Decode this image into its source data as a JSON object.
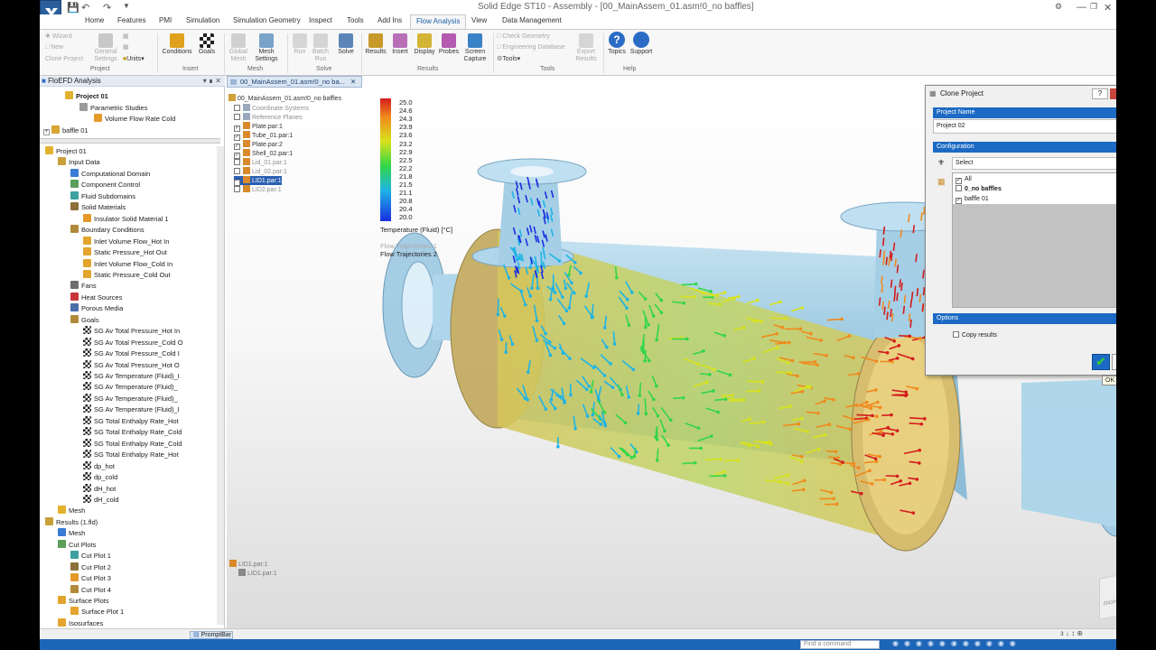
{
  "window": {
    "title": "Solid Edge ST10 - Assembly - [00_MainAssem_01.asm!0_no baffles]"
  },
  "ribbon_tabs": [
    "Home",
    "Features",
    "PMI",
    "Simulation",
    "Simulation Geometry",
    "Inspect",
    "Tools",
    "Add Ins",
    "Flow Analysis",
    "View",
    "Data Management"
  ],
  "ribbon": {
    "project": {
      "wizard": "Wizard",
      "new": "New",
      "clone": "Clone Project",
      "general": "General Settings",
      "units": "Units",
      "group": "Project"
    },
    "insert": {
      "conditions": "Conditions",
      "goals": "Goals",
      "group": "Insert"
    },
    "mesh": {
      "global": "Global Mesh",
      "settings": "Mesh Settings",
      "group": "Mesh"
    },
    "solve": {
      "run": "Run",
      "batch": "Batch Run",
      "solve": "Solve",
      "group": "Solve"
    },
    "results": {
      "results": "Results",
      "insert": "Insert",
      "display": "Display",
      "probes": "Probes",
      "capture": "Screen Capture",
      "group": "Results"
    },
    "tools": {
      "check": "Check Geometry",
      "engdb": "Engineering Database",
      "tools": "Tools",
      "export": "Export Results",
      "group": "Tools"
    },
    "help": {
      "topics": "Topics",
      "support": "Support",
      "group": "Help"
    }
  },
  "left_pane": {
    "title": "FloEFD Analysis",
    "top_tree": [
      "Project 01",
      "Parametric Studies",
      "Volume Flow Rate Cold",
      "baffle 01"
    ],
    "tree": [
      "Project 01",
      "Input Data",
      "Computational Domain",
      "Component Control",
      "Fluid Subdomains",
      "Solid Materials",
      "Insulator Solid Material 1",
      "Boundary Conditions",
      "Inlet Volume Flow_Hot In",
      "Static Pressure_Hot Out",
      "Inlet Volume Flow_Cold In",
      "Static Pressure_Cold Out",
      "Fans",
      "Heat Sources",
      "Porous Media",
      "Goals",
      "SG Av Total Pressure_Hot In",
      "SG Av Total Pressure_Cold O",
      "SG Av Total Pressure_Cold I",
      "SG Av Total Pressure_Hot O",
      "SG Av Temperature (Fluid)_I",
      "SG Av Temperature (Fluid)_",
      "SG Av Temperature (Fluid)_",
      "SG Av Temperature (Fluid)_I",
      "SG Total Enthalpy Rate_Hot",
      "SG Total Enthalpy Rate_Cold",
      "SG Total Enthalpy Rate_Cold",
      "SG Total Enthalpy Rate_Hot",
      "dp_hot",
      "dp_cold",
      "dH_hot",
      "dH_cold",
      "Mesh",
      "Results (1.fld)",
      "Mesh",
      "Cut Plots",
      "Cut Plot 1",
      "Cut Plot 2",
      "Cut Plot 3",
      "Cut Plot 4",
      "Surface Plots",
      "Surface Plot 1",
      "Isosurfaces"
    ]
  },
  "viewport": {
    "doc_tab": "00_MainAssem_01.asm!0_no ba...",
    "assembly": "00_MainAssem_01.asm!0_no baffles",
    "parts": [
      "Coordinate Systems",
      "Reference Planes",
      "Plate.par:1",
      "Tube_01.par:1",
      "Plate.par:2",
      "Shell_02.par:1",
      "Lid_01.par:1",
      "Lid_02.par:1",
      "LID1.par:1",
      "LID2.par:1"
    ],
    "legend_title": "Temperature (Fluid) [°C]",
    "legend_values": [
      "25.0",
      "24.6",
      "24.3",
      "23.9",
      "23.6",
      "23.2",
      "22.9",
      "22.5",
      "22.2",
      "21.8",
      "21.5",
      "21.1",
      "20.8",
      "20.4",
      "20.0"
    ],
    "trajectories": [
      "Flow Trajectories 1",
      "Flow Trajectories 2"
    ],
    "bottom_list": [
      "LID1.par:1",
      "LID1.par:1"
    ],
    "view_cube": "RIGHT",
    "prompt_bar": "PromptBar",
    "command_finder": "Find a command"
  },
  "dialog": {
    "title": "Clone Project",
    "project_name_header": "Project Name",
    "project_name": "Project 02",
    "configuration_header": "Configuration",
    "select": "Select",
    "configs": [
      {
        "label": "All",
        "checked": true,
        "bold": false
      },
      {
        "label": "0_no baffles",
        "checked": false,
        "bold": true
      },
      {
        "label": "baffle 01",
        "checked": true,
        "bold": false
      }
    ],
    "options_header": "Options",
    "copy_results": "Copy results",
    "ok_tooltip": "OK"
  },
  "colors": {
    "accent": "#1c6ac4",
    "hot": "#d41c1c",
    "cold": "#1a2ee0",
    "shell": "#9dc8e2"
  }
}
